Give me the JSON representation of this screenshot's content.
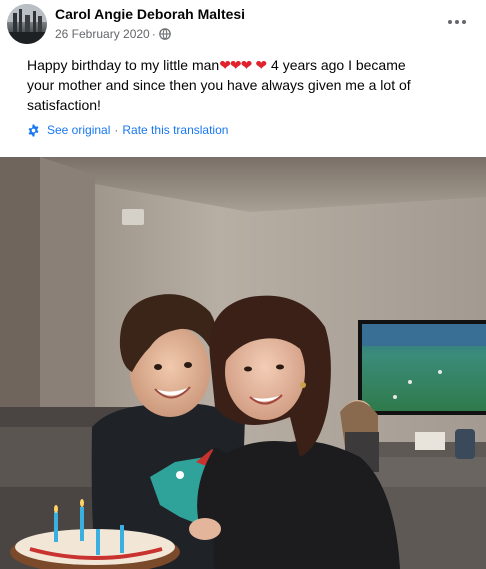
{
  "post": {
    "author": "Carol Angie Deborah Maltesi",
    "date": "26 February 2020",
    "separator": "·",
    "icons": {
      "avatar": "cityscape-avatar",
      "audience": "globe-icon",
      "options": "more-options-icon"
    },
    "text_line1_before": "Happy birthday to my little man",
    "hearts": "❤❤❤",
    "heart_single": "❤",
    "text_line1_after": " 4 years ago I became",
    "text_line2": "your mother and since then you have always given me a lot of",
    "text_line3": "satisfaction!",
    "translation": {
      "see_original": "See original",
      "separator": "·",
      "rate": "Rate this translation",
      "icon": "gear-icon"
    },
    "photo": {
      "subject": "mother-and-son-birthday-photo",
      "heart_color": "#e0222d"
    }
  },
  "colors": {
    "link": "#1877f2",
    "secondary_text": "#65676b",
    "primary_text": "#050505"
  }
}
